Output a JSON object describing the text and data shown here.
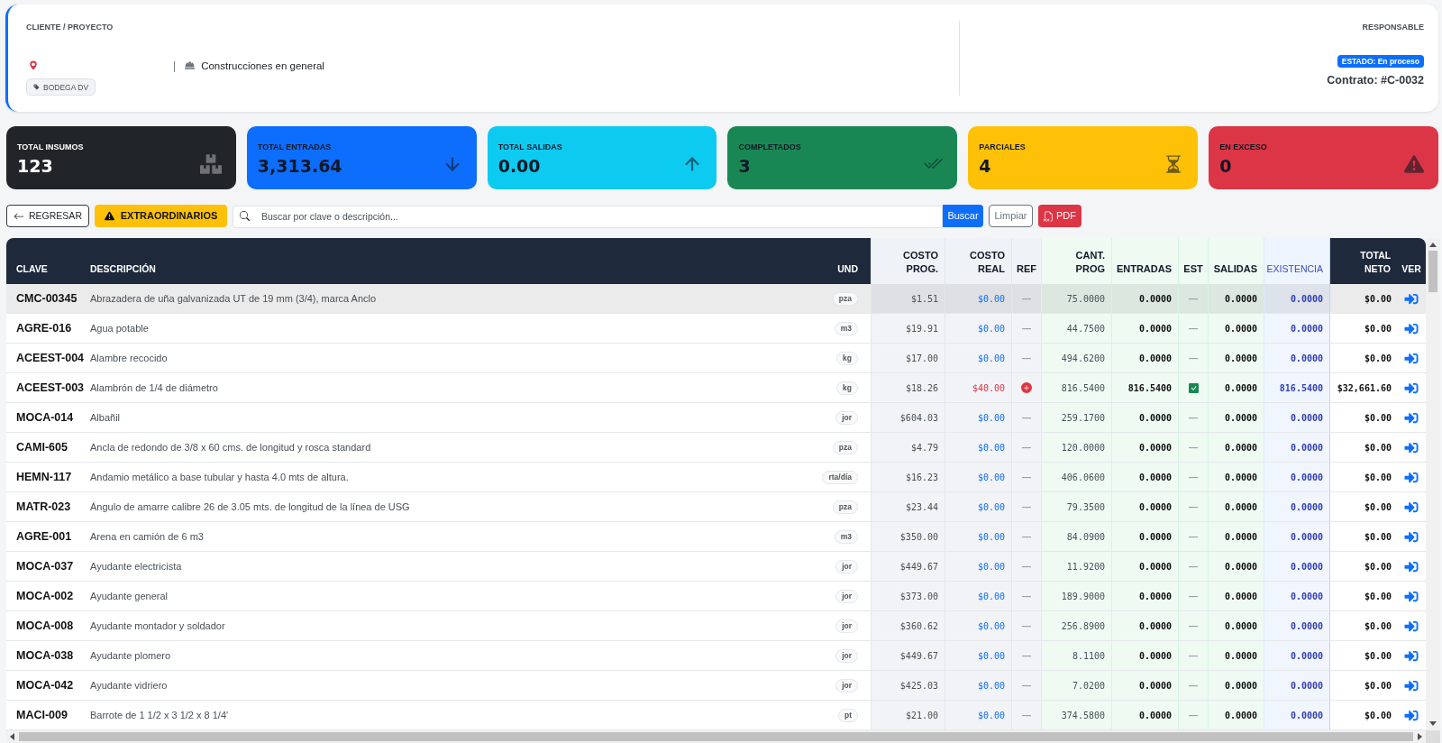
{
  "header": {
    "client_label": "CLIENTE / PROYECTO",
    "separator": "|",
    "project_type": "Construcciones en general",
    "tag": "BODEGA DV",
    "responsible_label": "RESPONSABLE",
    "status": "ESTADO: En proceso",
    "contract": "Contrato: #C-0032"
  },
  "stats": [
    {
      "kind": "total",
      "label": "TOTAL INSUMOS",
      "value": "123",
      "color": "#212529"
    },
    {
      "kind": "in",
      "label": "TOTAL ENTRADAS",
      "value": "3,313.64",
      "color": "#0d6efd"
    },
    {
      "kind": "out",
      "label": "TOTAL SALIDAS",
      "value": "0.00",
      "color": "#0dcaf0"
    },
    {
      "kind": "complete",
      "label": "COMPLETADOS",
      "value": "3",
      "color": "#198754"
    },
    {
      "kind": "partial",
      "label": "PARCIALES",
      "value": "4",
      "color": "#ffc107"
    },
    {
      "kind": "excess",
      "label": "EN EXCESO",
      "value": "0",
      "color": "#dc3545"
    }
  ],
  "toolbar": {
    "back_button": "REGRESAR",
    "extraordinary_button": "EXTRAORDINARIOS",
    "search": {
      "placeholder": "Buscar por clave o descripción..."
    },
    "search_button": "Buscar",
    "clear_button": "Limpiar",
    "pdf_button": "PDF"
  },
  "table": {
    "columns": [
      {
        "label": "CLAVE",
        "kind": "main"
      },
      {
        "label": "DESCRIPCIÓN",
        "kind": "main"
      },
      {
        "label": "UND",
        "kind": "main"
      },
      {
        "label": "COSTO PROG.",
        "kind": "cost"
      },
      {
        "label": "COSTO REAL",
        "kind": "cost"
      },
      {
        "label": "REF",
        "kind": "cost"
      },
      {
        "label": "CANT. PROG",
        "kind": "movement"
      },
      {
        "label": "ENTRADAS",
        "kind": "movement"
      },
      {
        "label": "EST",
        "kind": "movement"
      },
      {
        "label": "SALIDAS",
        "kind": "movement"
      },
      {
        "label": "EXISTENCIA",
        "kind": "stock"
      },
      {
        "label": "TOTAL NETO",
        "kind": "total"
      },
      {
        "label": "VER",
        "kind": "total"
      }
    ],
    "rows": [
      {
        "highlighted": true,
        "code": "CMC-00345",
        "description": "Abrazadera de uña galvanizada UT de 19 mm (3/4), marca Anclo",
        "unit": "pza",
        "cost_prog": "$1.51",
        "cost_real": "$0.00",
        "over_budget": false,
        "ref": {
          "kind": "none",
          "text": "—"
        },
        "qty_prog": "75.0000",
        "entries": "0.0000",
        "est": {
          "kind": "none",
          "text": "—"
        },
        "exits": "0.0000",
        "stock": "0.0000",
        "total": "$0.00"
      },
      {
        "highlighted": false,
        "code": "AGRE-016",
        "description": "Agua potable",
        "unit": "m3",
        "cost_prog": "$19.91",
        "cost_real": "$0.00",
        "over_budget": false,
        "ref": {
          "kind": "none",
          "text": "—"
        },
        "qty_prog": "44.7500",
        "entries": "0.0000",
        "est": {
          "kind": "none",
          "text": "—"
        },
        "exits": "0.0000",
        "stock": "0.0000",
        "total": "$0.00"
      },
      {
        "highlighted": false,
        "code": "ACEEST-004",
        "description": "Alambre recocido",
        "unit": "kg",
        "cost_prog": "$17.00",
        "cost_real": "$0.00",
        "over_budget": false,
        "ref": {
          "kind": "none",
          "text": "—"
        },
        "qty_prog": "494.6200",
        "entries": "0.0000",
        "est": {
          "kind": "none",
          "text": "—"
        },
        "exits": "0.0000",
        "stock": "0.0000",
        "total": "$0.00"
      },
      {
        "highlighted": false,
        "code": "ACEEST-003",
        "description": "Alambrón de 1/4 de diámetro",
        "unit": "kg",
        "cost_prog": "$18.26",
        "cost_real": "$40.00",
        "over_budget": true,
        "ref": {
          "kind": "alert"
        },
        "qty_prog": "816.5400",
        "entries": "816.5400",
        "est": {
          "kind": "complete"
        },
        "exits": "0.0000",
        "stock": "816.5400",
        "total": "$32,661.60"
      },
      {
        "highlighted": false,
        "code": "MOCA-014",
        "description": "Albañil",
        "unit": "jor",
        "cost_prog": "$604.03",
        "cost_real": "$0.00",
        "over_budget": false,
        "ref": {
          "kind": "none",
          "text": "—"
        },
        "qty_prog": "259.1700",
        "entries": "0.0000",
        "est": {
          "kind": "none",
          "text": "—"
        },
        "exits": "0.0000",
        "stock": "0.0000",
        "total": "$0.00"
      },
      {
        "highlighted": false,
        "code": "CAMI-605",
        "description": "Ancla de redondo de 3/8 x 60 cms. de longitud y rosca standard",
        "unit": "pza",
        "cost_prog": "$4.79",
        "cost_real": "$0.00",
        "over_budget": false,
        "ref": {
          "kind": "none",
          "text": "—"
        },
        "qty_prog": "120.0000",
        "entries": "0.0000",
        "est": {
          "kind": "none",
          "text": "—"
        },
        "exits": "0.0000",
        "stock": "0.0000",
        "total": "$0.00"
      },
      {
        "highlighted": false,
        "code": "HEMN-117",
        "description": "Andamio metálico a base tubular y hasta 4.0 mts de altura.",
        "unit": "rta/día",
        "cost_prog": "$16.23",
        "cost_real": "$0.00",
        "over_budget": false,
        "ref": {
          "kind": "none",
          "text": "—"
        },
        "qty_prog": "406.0600",
        "entries": "0.0000",
        "est": {
          "kind": "none",
          "text": "—"
        },
        "exits": "0.0000",
        "stock": "0.0000",
        "total": "$0.00"
      },
      {
        "highlighted": false,
        "code": "MATR-023",
        "description": "Ángulo de amarre calibre 26 de 3.05 mts. de longitud de la línea de USG",
        "unit": "pza",
        "cost_prog": "$23.44",
        "cost_real": "$0.00",
        "over_budget": false,
        "ref": {
          "kind": "none",
          "text": "—"
        },
        "qty_prog": "79.3500",
        "entries": "0.0000",
        "est": {
          "kind": "none",
          "text": "—"
        },
        "exits": "0.0000",
        "stock": "0.0000",
        "total": "$0.00"
      },
      {
        "highlighted": false,
        "code": "AGRE-001",
        "description": "Arena en camión de 6 m3",
        "unit": "m3",
        "cost_prog": "$350.00",
        "cost_real": "$0.00",
        "over_budget": false,
        "ref": {
          "kind": "none",
          "text": "—"
        },
        "qty_prog": "84.0900",
        "entries": "0.0000",
        "est": {
          "kind": "none",
          "text": "—"
        },
        "exits": "0.0000",
        "stock": "0.0000",
        "total": "$0.00"
      },
      {
        "highlighted": false,
        "code": "MOCA-037",
        "description": "Ayudante electricista",
        "unit": "jor",
        "cost_prog": "$449.67",
        "cost_real": "$0.00",
        "over_budget": false,
        "ref": {
          "kind": "none",
          "text": "—"
        },
        "qty_prog": "11.9200",
        "entries": "0.0000",
        "est": {
          "kind": "none",
          "text": "—"
        },
        "exits": "0.0000",
        "stock": "0.0000",
        "total": "$0.00"
      },
      {
        "highlighted": false,
        "code": "MOCA-002",
        "description": "Ayudante general",
        "unit": "jor",
        "cost_prog": "$373.00",
        "cost_real": "$0.00",
        "over_budget": false,
        "ref": {
          "kind": "none",
          "text": "—"
        },
        "qty_prog": "189.9000",
        "entries": "0.0000",
        "est": {
          "kind": "none",
          "text": "—"
        },
        "exits": "0.0000",
        "stock": "0.0000",
        "total": "$0.00"
      },
      {
        "highlighted": false,
        "code": "MOCA-008",
        "description": "Ayudante montador y soldador",
        "unit": "jor",
        "cost_prog": "$360.62",
        "cost_real": "$0.00",
        "over_budget": false,
        "ref": {
          "kind": "none",
          "text": "—"
        },
        "qty_prog": "256.8900",
        "entries": "0.0000",
        "est": {
          "kind": "none",
          "text": "—"
        },
        "exits": "0.0000",
        "stock": "0.0000",
        "total": "$0.00"
      },
      {
        "highlighted": false,
        "code": "MOCA-038",
        "description": "Ayudante plomero",
        "unit": "jor",
        "cost_prog": "$449.67",
        "cost_real": "$0.00",
        "over_budget": false,
        "ref": {
          "kind": "none",
          "text": "—"
        },
        "qty_prog": "8.1100",
        "entries": "0.0000",
        "est": {
          "kind": "none",
          "text": "—"
        },
        "exits": "0.0000",
        "stock": "0.0000",
        "total": "$0.00"
      },
      {
        "highlighted": false,
        "code": "MOCA-042",
        "description": "Ayudante vidriero",
        "unit": "jor",
        "cost_prog": "$425.03",
        "cost_real": "$0.00",
        "over_budget": false,
        "ref": {
          "kind": "none",
          "text": "—"
        },
        "qty_prog": "7.0200",
        "entries": "0.0000",
        "est": {
          "kind": "none",
          "text": "—"
        },
        "exits": "0.0000",
        "stock": "0.0000",
        "total": "$0.00"
      },
      {
        "highlighted": false,
        "code": "MACI-009",
        "description": "Barrote de 1 1/2 x 3 1/2 x 8 1/4'",
        "unit": "pt",
        "cost_prog": "$21.00",
        "cost_real": "$0.00",
        "over_budget": false,
        "ref": {
          "kind": "none",
          "text": "—"
        },
        "qty_prog": "374.5800",
        "entries": "0.0000",
        "est": {
          "kind": "none",
          "text": "—"
        },
        "exits": "0.0000",
        "stock": "0.0000",
        "total": "$0.00"
      }
    ]
  }
}
